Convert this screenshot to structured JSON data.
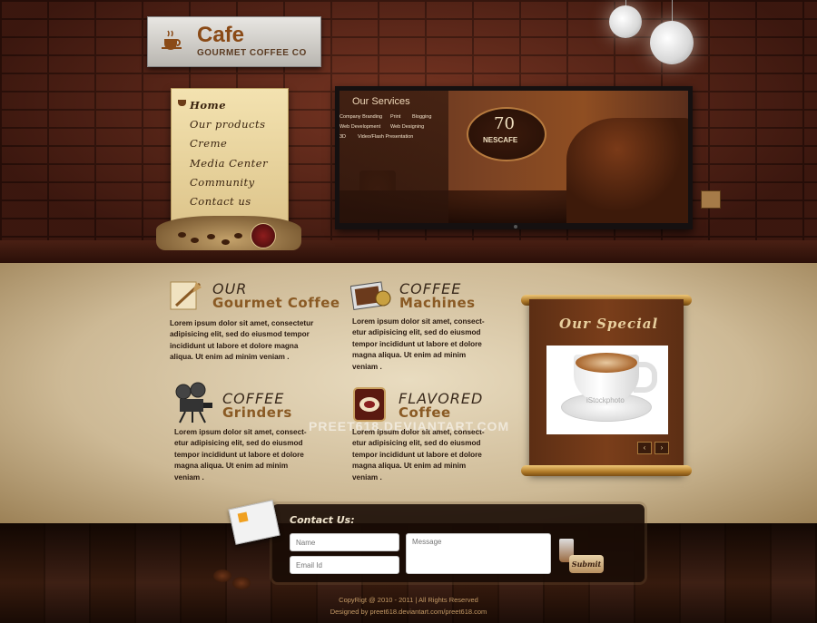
{
  "logo": {
    "title": "Cafe",
    "subtitle": "GOURMET COFFEE CO"
  },
  "menu": {
    "items": [
      "Home",
      "Our products",
      "Creme",
      "Media Center",
      "Community",
      "Contact us"
    ]
  },
  "slider": {
    "title": "Our Services",
    "services": [
      "Company Branding",
      "Print",
      "Blogging",
      "Web Development",
      "Web Designing",
      "3D",
      "Video/Flash Presentation"
    ],
    "brand_number": "70",
    "brand_name": "NESCAFE"
  },
  "features": [
    {
      "line1": "OUR",
      "line2": "Gourmet Coffee",
      "body": [
        "Lorem ipsum dolor sit amet, consectetur",
        "adipisicing elit, sed do eiusmod tempor",
        "incididunt ut labore et dolore magna",
        "aliqua. Ut enim ad minim veniam ."
      ]
    },
    {
      "line1": "COFFEE",
      "line2": "Machines",
      "body": [
        "Lorem ipsum dolor sit amet, consect-",
        "etur adipisicing elit, sed do eiusmod",
        "tempor incididunt ut labore et dolore",
        "magna aliqua. Ut enim ad minim",
        "veniam ."
      ]
    },
    {
      "line1": "COFFEE",
      "line2": "Grinders",
      "body": [
        "Lorem ipsum dolor sit amet, consect-",
        "etur adipisicing elit, sed do eiusmod",
        "tempor incididunt ut labore et dolore",
        "magna aliqua. Ut enim ad minim",
        "veniam ."
      ]
    },
    {
      "line1": "FLAVORED",
      "line2": "Coffee",
      "body": [
        "Lorem ipsum dolor sit amet, consect-",
        "etur adipisicing elit, sed do eiusmod",
        "tempor incididunt ut labore et dolore",
        "magna aliqua. Ut enim ad minim",
        "veniam ."
      ]
    }
  ],
  "special": {
    "title": "Our Special",
    "watermark": "iStockphoto",
    "prev": "‹",
    "next": "›"
  },
  "page_watermark": "PREET618.DEVIANTART.COM",
  "contact": {
    "title": "Contact Us:",
    "name_placeholder": "Name",
    "email_placeholder": "Email Id",
    "message_placeholder": "Message",
    "submit_label": "Submit"
  },
  "footer": {
    "copyright": "CopyRigt @ 2010 - 2011    |    All Rights Reserved",
    "credit": "Designed by preet618.deviantart.com/preet618.com"
  },
  "colors": {
    "accent": "#8a5a24",
    "brick": "#6b2d1e",
    "parchment": "#e9dcc0",
    "dark": "#2a1a10"
  }
}
